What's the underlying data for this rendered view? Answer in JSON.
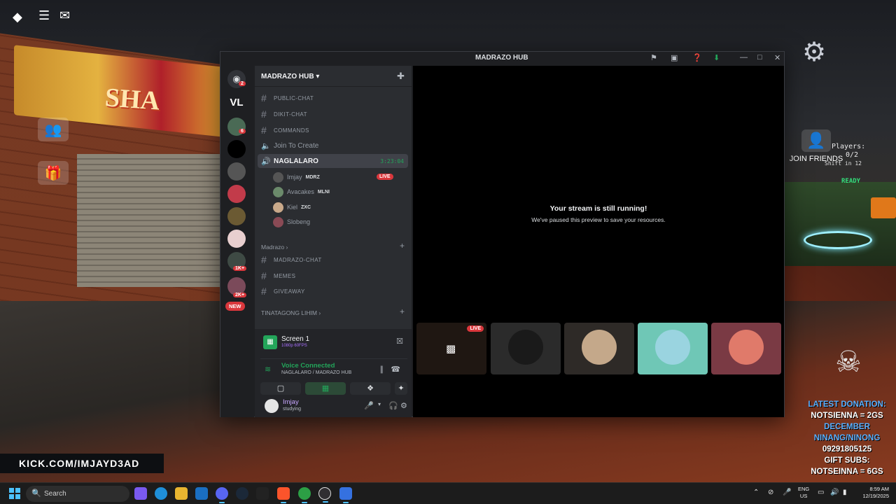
{
  "game": {
    "banner_text": "SHA",
    "join_friends_label": "JOIN FRIENDS",
    "players_label": "Players:",
    "players_count": "0/2",
    "shift_text": "Shift in 12",
    "ready_label": "READY",
    "kick_url": "KICK.COM/IMJAYD3AD",
    "donation": [
      {
        "text": "LATEST DONATION:",
        "color": "blue"
      },
      {
        "text": "NOTSIENNA = 2GS",
        "color": "white"
      },
      {
        "text": "DECEMBER",
        "color": "blue"
      },
      {
        "text": "NINANG/NINONG",
        "color": "blue"
      },
      {
        "text": "09291805125",
        "color": "white"
      },
      {
        "text": "GIFT SUBS:",
        "color": "white"
      },
      {
        "text": "NOTSEINNA = 6GS",
        "color": "white"
      }
    ]
  },
  "discord": {
    "window_title": "MADRAZO HUB",
    "server_name": "MADRAZO HUB",
    "servers": [
      {
        "icon": "discord-home",
        "badge": "2"
      },
      {
        "icon": "vl-server",
        "label": "VL"
      },
      {
        "icon": "server-2",
        "badge": "6"
      },
      {
        "icon": "server-3"
      },
      {
        "icon": "server-4"
      },
      {
        "icon": "server-5"
      },
      {
        "icon": "server-6"
      },
      {
        "icon": "server-7"
      },
      {
        "icon": "server-8",
        "badge": "1K+"
      },
      {
        "icon": "server-9",
        "badge": "2K+"
      },
      {
        "icon": "new-badge",
        "label": "NEW"
      }
    ],
    "channels_top": [
      {
        "type": "text",
        "label": "PUBLIC-CHAT"
      },
      {
        "type": "text",
        "label": "DIKIT-CHAT"
      },
      {
        "type": "text",
        "label": "COMMANDS"
      },
      {
        "type": "voice",
        "label": "Join To Create"
      }
    ],
    "active_voice": {
      "label": "NAGLALARO",
      "timer": "3:23:04"
    },
    "voice_users": [
      {
        "name": "Imjay",
        "tag": "MDRZ",
        "live": "LIVE"
      },
      {
        "name": "Avacakes",
        "tag": "MLNI"
      },
      {
        "name": "Kiel",
        "tag": "ZXC"
      },
      {
        "name": "Slobeng"
      }
    ],
    "category_madrazo": "Madrazo",
    "channels_madrazo": [
      {
        "label": "MADRAZO-CHAT"
      },
      {
        "label": "MEMES"
      },
      {
        "label": "GIVEAWAY"
      }
    ],
    "category_hidden": "TINATAGONG LIHIM",
    "stream": {
      "name": "Screen 1",
      "quality": "1080p 60FPS"
    },
    "voice_connected": {
      "title": "Voice Connected",
      "sub": "NAGLALARO / MADRAZO HUB"
    },
    "user": {
      "name": "Imjay",
      "status": "studying"
    },
    "stage": {
      "message_title": "Your stream is still running!",
      "message_sub": "We've paused this preview to save your resources.",
      "live_label": "LIVE"
    },
    "tile_colors": [
      "#1f1712",
      "#2b2b2b",
      "#2e2a27",
      "#6fc7b6",
      "#7a3a44"
    ]
  },
  "taskbar": {
    "search_placeholder": "Search",
    "lang_line1": "ENG",
    "lang_line2": "US",
    "time": "8:59 AM",
    "date": "12/19/2025",
    "apps": [
      "copilot-icon",
      "edge-icon",
      "file-explorer-icon",
      "outlook-icon",
      "discord-icon",
      "steam-icon",
      "app-icon",
      "brave-icon",
      "chrome-icon",
      "obs-icon",
      "roblox-icon"
    ]
  }
}
